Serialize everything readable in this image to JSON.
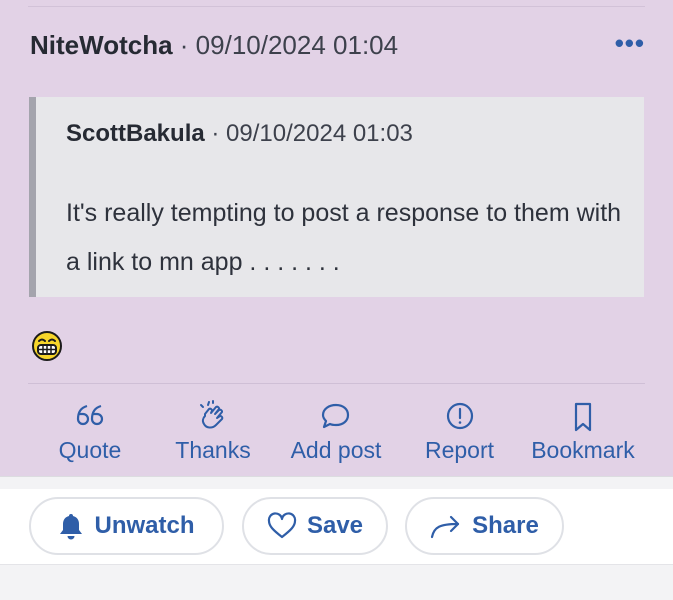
{
  "post": {
    "author": "NiteWotcha",
    "separator": "·",
    "date": "09/10/2024 01:04",
    "more": "•••",
    "quote": {
      "author": "ScottBakula",
      "separator": "·",
      "date": "09/10/2024 01:03",
      "text": "It's really tempting to post a response to them with a link to mn app . . . . . . ."
    },
    "reaction_emoji": "laughing-grimace-emoji"
  },
  "actions": [
    {
      "label": "Quote",
      "icon": "quote-icon"
    },
    {
      "label": "Thanks",
      "icon": "clap-icon"
    },
    {
      "label": "Add post",
      "icon": "speech-bubble-icon"
    },
    {
      "label": "Report",
      "icon": "exclamation-circle-icon"
    },
    {
      "label": "Bookmark",
      "icon": "bookmark-icon"
    }
  ],
  "bottom_bar": {
    "unwatch": "Unwatch",
    "save": "Save",
    "share": "Share"
  },
  "colors": {
    "post_background": "#e2d2e6",
    "accent": "#2f5ea8",
    "quote_background": "#e7e7ea",
    "quote_border": "#a4a4ad"
  }
}
